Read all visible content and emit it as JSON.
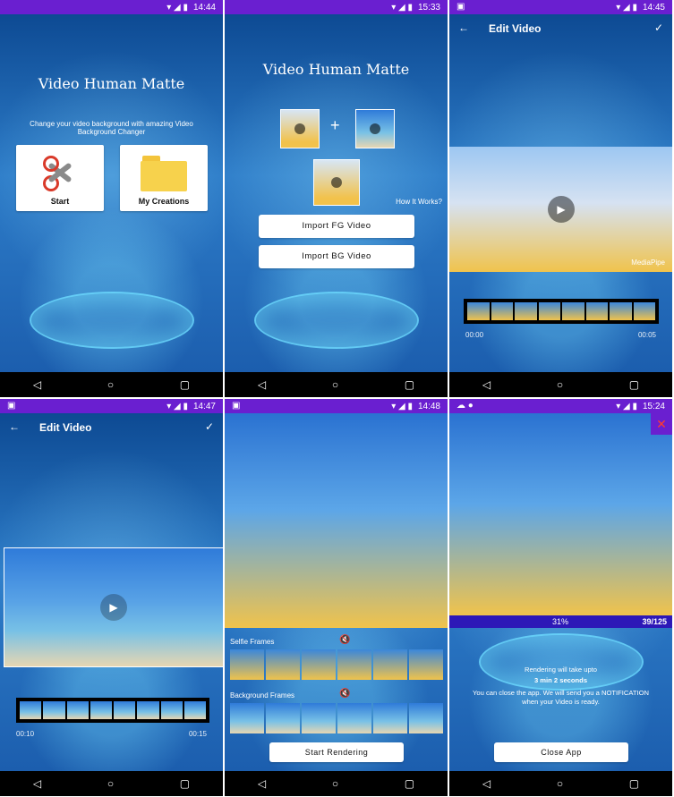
{
  "phones": [
    {
      "status_time": "14:44",
      "title": "Video Human Matte",
      "tagline": "Change your video background with amazing Video Background Changer",
      "cards": [
        {
          "label": "Start",
          "icon": "scissors-icon"
        },
        {
          "label": "My Creations",
          "icon": "folder-icon"
        }
      ]
    },
    {
      "status_time": "15:33",
      "title": "Video Human Matte",
      "how_it_works": "How It Works?",
      "import_fg": "Import FG Video",
      "import_bg": "Import BG Video"
    },
    {
      "status_time": "14:45",
      "title": "Edit Video",
      "time_start": "00:00",
      "time_end": "00:05",
      "watermark": "MediaPipe"
    },
    {
      "status_time": "14:47",
      "title": "Edit Video",
      "time_start": "00:10",
      "time_end": "00:15"
    },
    {
      "status_time": "14:48",
      "selfie_frames": "Selfie Frames",
      "background_frames": "Background Frames",
      "start_rendering": "Start Rendering"
    },
    {
      "status_time": "15:24",
      "progress_percent": "31%",
      "progress_frames": "39/125",
      "rendering_msg": "Rendering will take upto",
      "rendering_time": "3 min 2 seconds",
      "notify_msg": "You can close the app. We will send you a NOTIFICATION when your Video is ready.",
      "close_app": "Close App"
    }
  ],
  "colors": {
    "status_bar": "#6a1fd0",
    "progress_bar": "#2d18b7",
    "close_x": "#ff3b30"
  }
}
